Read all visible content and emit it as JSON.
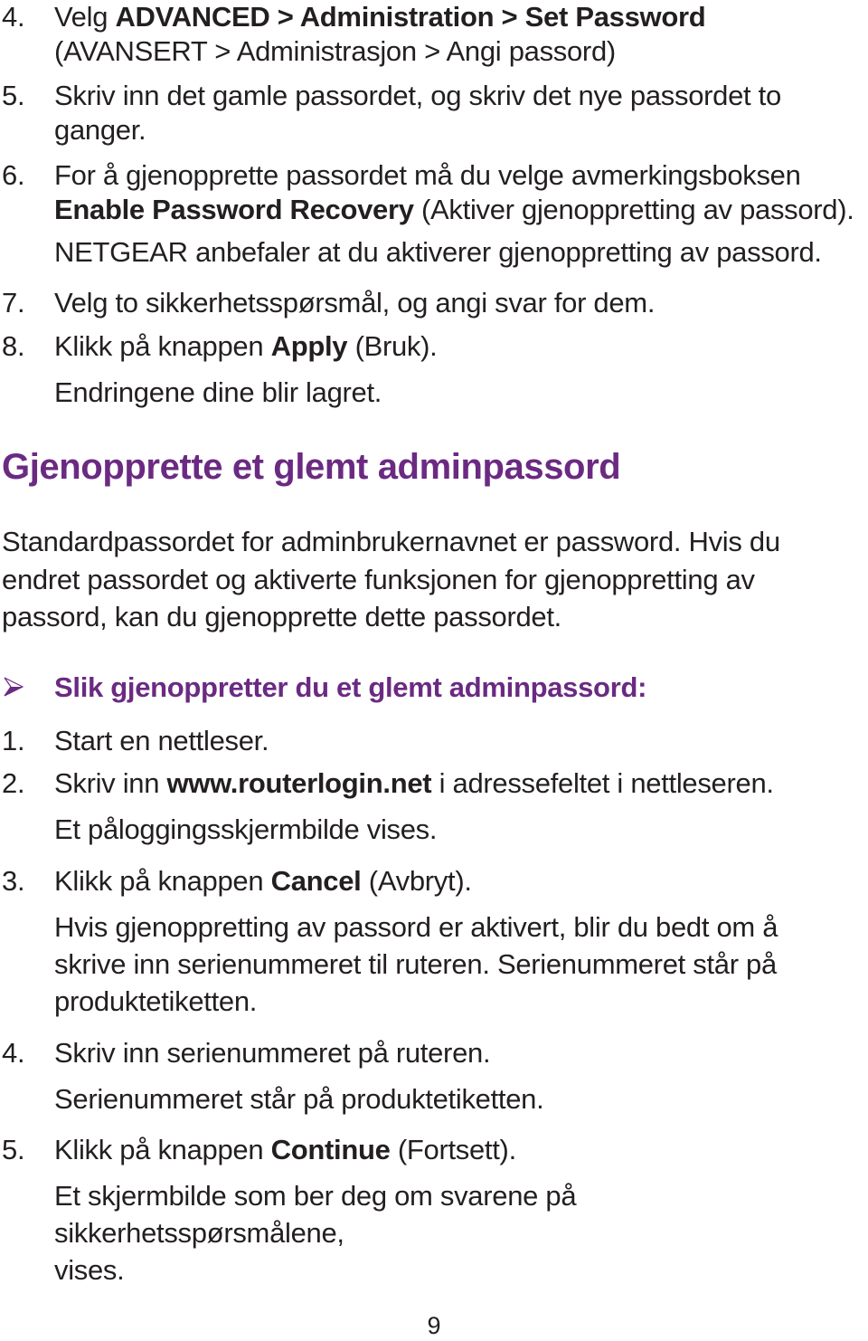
{
  "steps_top": [
    {
      "num": "4.",
      "pre": "Velg ",
      "bold": "ADVANCED > Administration > Set Password",
      "post": "",
      "line2": "(AVANSERT > Administrasjon > Angi passord)"
    },
    {
      "num": "5.",
      "line1": "Skriv inn det gamle passordet, og skriv det nye passordet to",
      "line2": "ganger."
    },
    {
      "num": "6.",
      "line1": "For å gjenopprette passordet må du velge avmerkingsboksen",
      "bold": "Enable Password Recovery",
      "post": " (Aktiver gjenoppretting av passord).",
      "note": "NETGEAR anbefaler at du aktiverer gjenoppretting av passord."
    },
    {
      "num": "7.",
      "line1": "Velg to sikkerhetsspørsmål, og angi svar for dem."
    },
    {
      "num": "8.",
      "pre": "Klikk på knappen ",
      "bold": "Apply",
      "post": " (Bruk).",
      "note": "Endringene dine blir lagret."
    }
  ],
  "section": {
    "heading": "Gjenopprette et glemt adminpassord",
    "intro_lines": [
      "Standardpassordet for adminbrukernavnet er password. Hvis du",
      "endret passordet og aktiverte funksjonen for gjenoppretting av",
      "passord, kan du gjenopprette dette passordet."
    ],
    "procedure_icon": "arrow-bullet-icon",
    "procedure_title": "Slik gjenoppretter du et glemt adminpassord:"
  },
  "steps_bottom": [
    {
      "num": "1.",
      "line1": "Start en nettleser."
    },
    {
      "num": "2.",
      "pre": "Skriv inn ",
      "bold": "www.routerlogin.net",
      "post": " i adressefeltet i nettleseren.",
      "note": "Et påloggingsskjermbilde vises."
    },
    {
      "num": "3.",
      "pre": "Klikk på knappen ",
      "bold": "Cancel",
      "post": " (Avbryt).",
      "note_lines": [
        "Hvis gjenoppretting av passord er aktivert, blir du bedt om å",
        "skrive inn serienummeret til ruteren. Serienummeret står på",
        "produktetiketten."
      ]
    },
    {
      "num": "4.",
      "line1": "Skriv inn serienummeret på ruteren.",
      "note": "Serienummeret står på produktetiketten."
    },
    {
      "num": "5.",
      "pre": "Klikk på knappen ",
      "bold": "Continue",
      "post": " (Fortsett).",
      "note_lines": [
        "Et skjermbilde som ber deg om svarene på sikkerhetsspørsmålene,",
        "vises."
      ]
    }
  ],
  "footer": {
    "page_number": "9"
  },
  "colors": {
    "heading": "#6b2a82",
    "text": "#231f20"
  }
}
